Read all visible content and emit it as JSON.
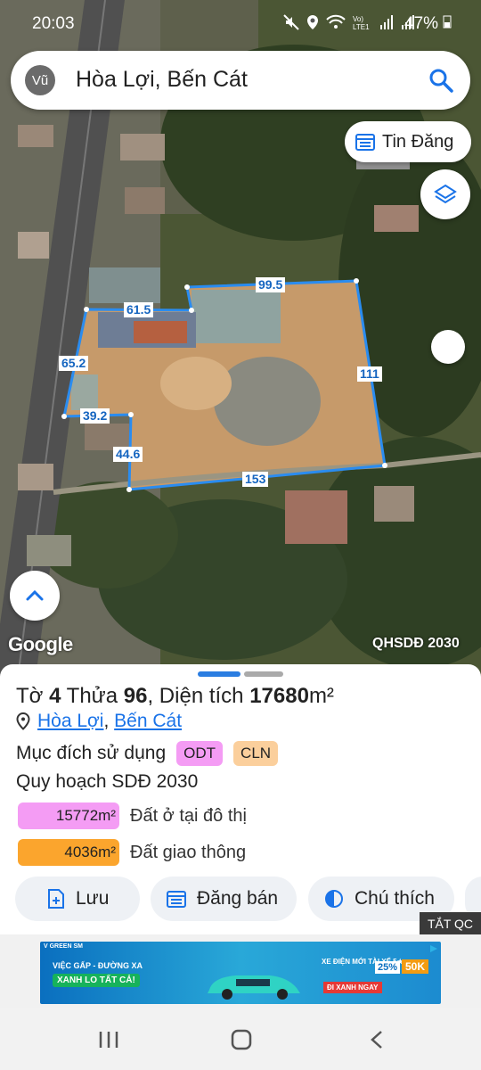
{
  "status_bar": {
    "time": "20:03",
    "battery": "47%",
    "icons": [
      "mute-icon",
      "location-icon",
      "wifi-icon",
      "volte-icon",
      "signal-icon",
      "signal-icon",
      "battery-icon"
    ],
    "volte_label": "Vo)\nLTE1"
  },
  "search": {
    "avatar_text": "Vũ",
    "query": "Hòa Lợi, Bến Cát"
  },
  "map": {
    "tin_dang_label": "Tin Đăng",
    "google_label": "Google",
    "layer_label": "QHSDĐ 2030",
    "edge_labels": [
      "99.5",
      "61.5",
      "65.2",
      "111",
      "39.2",
      "44.6",
      "153"
    ]
  },
  "panel": {
    "parcel_prefix": "Tờ ",
    "sheet_no": "4",
    "parcel_mid": " Thửa ",
    "parcel_no": "96",
    "area_prefix": ", Diện tích ",
    "area_value": "17680",
    "area_unit": "m²",
    "location_ward": "Hòa Lợi",
    "location_sep": ", ",
    "location_district": "Bến Cát",
    "purpose_label": "Mục đích sử dụng",
    "purpose_codes": [
      "ODT",
      "CLN"
    ],
    "plan_label": "Quy hoạch SDĐ 2030",
    "legend": [
      {
        "area": "15772m²",
        "label": "Đất ở tại đô thị",
        "color": "#f49cf4"
      },
      {
        "area": "4036m²",
        "label": "Đất giao thông",
        "color": "#fba52d"
      }
    ],
    "actions": {
      "save": "Lưu",
      "sell": "Đăng bán",
      "legend": "Chú thích"
    }
  },
  "ad": {
    "close_label": "TẮT QC",
    "brand": "V GREEN SM",
    "headline": "VIỆC GẤP - ĐƯỜNG XA",
    "slogan": "XANH LO TẤT CẢ!",
    "tagline": "XE ĐIỆN MỚI TÀI XẾ 5★",
    "cta": "ĐI XANH NGAY",
    "promo_percent": "25%",
    "promo_amount": "50K"
  },
  "nav_bar": {
    "icons": [
      "recents-icon",
      "home-icon",
      "back-icon"
    ]
  },
  "colors": {
    "accent": "#1a73e8",
    "plot_outline": "#2a8cf0",
    "odt": "#f49cf4",
    "cln": "#fbcf9c",
    "transport": "#fba52d"
  }
}
